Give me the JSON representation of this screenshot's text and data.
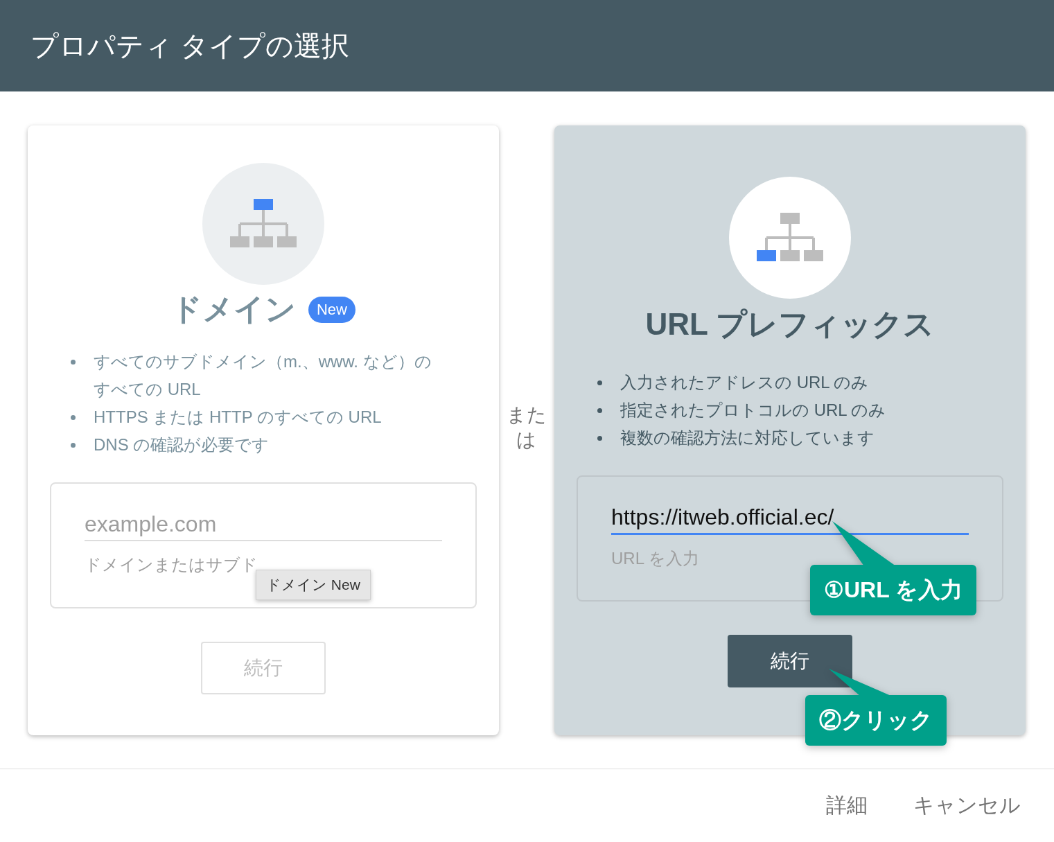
{
  "dialog": {
    "title": "プロパティ タイプの選択"
  },
  "property_types": [
    {
      "kind": "domain",
      "selected": false,
      "title": "ドメイン",
      "badge": "New",
      "bullets": [
        "すべてのサブドメイン（m.、www. など）のすべての URL",
        "HTTPS または HTTP のすべての URL",
        "DNS の確認が必要です"
      ],
      "field": {
        "placeholder": "example.com",
        "helper": "ドメインまたはサブド",
        "focused": false,
        "tooltip": "ドメイン New"
      },
      "button": {
        "label": "続行",
        "disabled": true
      }
    },
    {
      "kind": "url_prefix",
      "selected": true,
      "title": "URL プレフィックス",
      "bullets": [
        "入力されたアドレスの URL のみ",
        "指定されたプロトコルの URL のみ",
        "複数の確認方法に対応しています"
      ],
      "field": {
        "value": "https://itweb.official.ec/",
        "helper": "URL を入力",
        "focused": true
      },
      "button": {
        "label": "続行",
        "disabled": false
      }
    }
  ],
  "separator": "または",
  "callouts": [
    {
      "text": "①URL を入力"
    },
    {
      "text": "②クリック"
    }
  ],
  "footer_buttons": [
    "詳細",
    "キャンセル"
  ]
}
